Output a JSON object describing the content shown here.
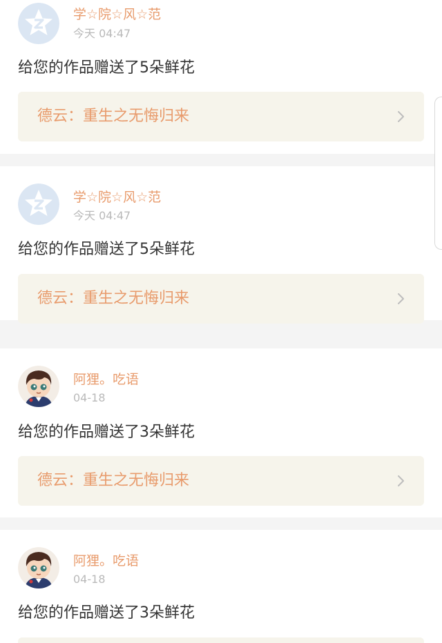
{
  "notifications": [
    {
      "username": "学☆院☆风☆范",
      "time": "今天 04:47",
      "avatar": "qq-default-avatar",
      "message": "给您的作品赠送了5朵鲜花",
      "work_title": "德云：重生之无悔归来"
    },
    {
      "username": "学☆院☆风☆范",
      "time": "今天 04:47",
      "avatar": "qq-default-avatar",
      "message": "给您的作品赠送了5朵鲜花",
      "work_title": "德云：重生之无悔归来"
    },
    {
      "username": "阿狸。吃语",
      "time": "04-18",
      "avatar": "cartoon-boy-avatar",
      "message": "给您的作品赠送了3朵鲜花",
      "work_title": "德云：重生之无悔归来"
    },
    {
      "username": "阿狸。吃语",
      "time": "04-18",
      "avatar": "cartoon-boy-avatar",
      "message": "给您的作品赠送了3朵鲜花",
      "work_title": ""
    }
  ],
  "colors": {
    "accent": "#e89b6c",
    "timestamp": "#b9b9b9",
    "message_text": "#333333",
    "link_background": "#f6f4eb",
    "separator": "#f4f4f4",
    "qq_avatar": "#dbe6f3"
  }
}
